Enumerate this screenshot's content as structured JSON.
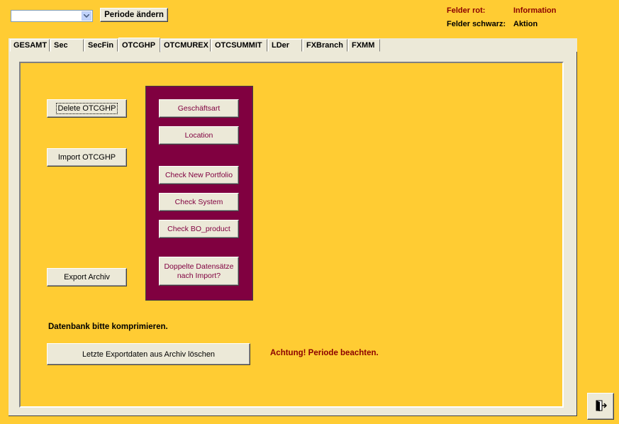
{
  "top": {
    "period_select": {
      "value": ""
    },
    "change_period_label": "Periode ändern",
    "legend": {
      "red_label": "Felder rot:",
      "red_value": "Information",
      "black_label": "Felder schwarz:",
      "black_value": "Aktion"
    }
  },
  "tabs": [
    "GESAMT",
    "Sec",
    "SecFin",
    "OTCGHP",
    "OTCMUREX",
    "OTCSUMMIT",
    "LDer",
    "FXBranch",
    "FXMM"
  ],
  "active_tab": "OTCGHP",
  "left_buttons": {
    "delete": "Delete OTCGHP",
    "import": "Import OTCGHP",
    "export": "Export Archiv"
  },
  "check_buttons": {
    "geschaeftsart": "Geschäftsart",
    "location": "Location",
    "new_portfolio": "Check New Portfolio",
    "system": "Check System",
    "bo_product": "Check BO_product",
    "duplicates_line1": "Doppelte Datensätze",
    "duplicates_line2": "nach Import?"
  },
  "compress_note": "Datenbank bitte komprimieren.",
  "delete_export_button": "Letzte Exportdaten aus Archiv  löschen",
  "warning": "Achtung! Periode beachten.",
  "colors": {
    "background": "#FFCC33",
    "panel_purple": "#800040",
    "info_red": "#8B0000"
  },
  "exit_icon": "exit-door-icon"
}
